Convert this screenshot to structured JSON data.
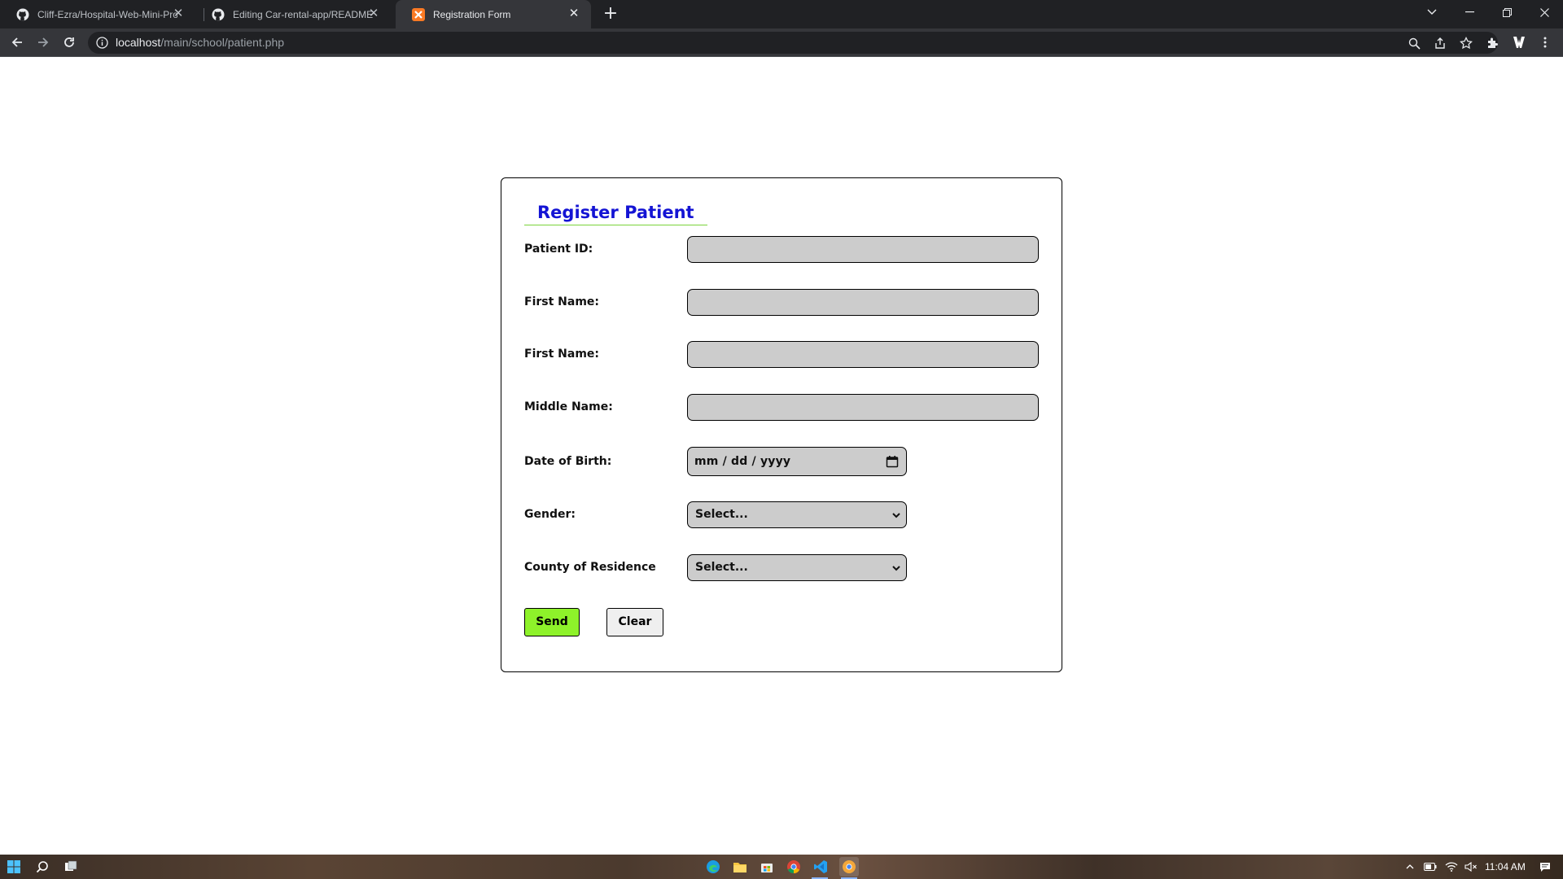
{
  "browser": {
    "tabs": [
      {
        "title": "Cliff-Ezra/Hospital-Web-Mini-Pro",
        "favicon": "github-icon",
        "active": false
      },
      {
        "title": "Editing Car-rental-app/README.m",
        "favicon": "github-icon",
        "active": false
      },
      {
        "title": "Registration Form",
        "favicon": "xampp-icon",
        "active": true
      }
    ],
    "url_host": "localhost",
    "url_path": "/main/school/patient.php"
  },
  "form": {
    "title": "Register Patient",
    "fields": [
      {
        "label": "Patient ID:",
        "type": "text",
        "value": ""
      },
      {
        "label": "First Name:",
        "type": "text",
        "value": ""
      },
      {
        "label": "First Name:",
        "type": "text",
        "value": ""
      },
      {
        "label": "Middle Name:",
        "type": "text",
        "value": ""
      },
      {
        "label": "Date of Birth:",
        "type": "date",
        "placeholder": "mm / dd / yyyy"
      },
      {
        "label": "Gender:",
        "type": "select",
        "selected": "Select..."
      },
      {
        "label": "County of Residence",
        "type": "select",
        "selected": "Select..."
      }
    ],
    "buttons": {
      "send": "Send",
      "clear": "Clear"
    }
  },
  "taskbar": {
    "clock": "11:04 AM",
    "apps": [
      "windows-start-icon",
      "search-icon",
      "task-view-icon",
      "edge-icon",
      "file-explorer-icon",
      "store-icon",
      "chrome-icon",
      "vscode-icon",
      "chrome-canary-icon"
    ]
  },
  "colors": {
    "title": "#1414d4",
    "title_underline": "#7ad33a",
    "send_button": "#8ef22a",
    "input_bg": "#cccccc",
    "chrome_dark": "#202124",
    "chrome_toolbar": "#35363a"
  }
}
